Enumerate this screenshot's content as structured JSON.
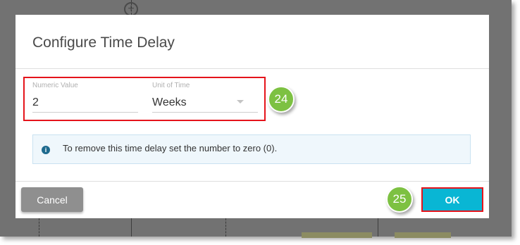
{
  "dialog": {
    "title": "Configure Time Delay",
    "numeric_field": {
      "label": "Numeric Value",
      "value": "2"
    },
    "unit_field": {
      "label": "Unit of Time",
      "value": "Weeks"
    },
    "info_message": "To remove this time delay set the number to zero (0).",
    "info_icon": "info-icon",
    "cancel_label": "Cancel",
    "ok_label": "OK"
  },
  "annotations": {
    "step_fields": "24",
    "step_ok": "25"
  },
  "colors": {
    "accent": "#09b6d4",
    "highlight": "#e5141b",
    "badge": "#7dc142",
    "info_background": "#eff7fc"
  }
}
